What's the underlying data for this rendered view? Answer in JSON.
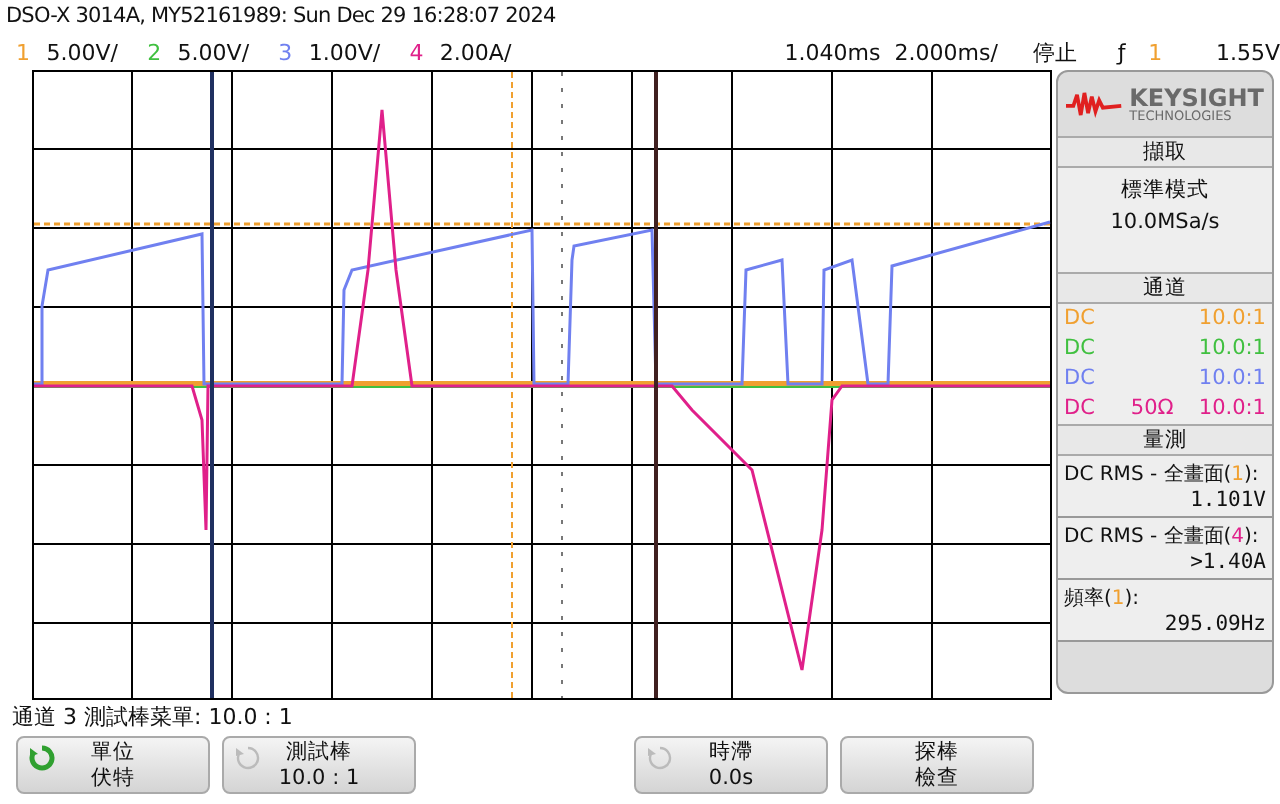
{
  "title": "DSO-X 3014A, MY52161989: Sun Dec 29 16:28:07 2024",
  "channels": [
    {
      "number": "1",
      "scale": "5.00V/",
      "color": "#f0a030"
    },
    {
      "number": "2",
      "scale": "5.00V/",
      "color": "#40c040"
    },
    {
      "number": "3",
      "scale": "1.00V/",
      "color": "#7080f0"
    },
    {
      "number": "4",
      "scale": "2.00A/",
      "color": "#e0208a"
    }
  ],
  "delay": "1.040ms",
  "timebase": "2.000ms/",
  "run_state": "停止",
  "trigger": {
    "slope": "ƒ",
    "channel": "1",
    "level": "1.55V",
    "color": "#f0a030"
  },
  "logo": {
    "brand": "KEYSIGHT",
    "sub": "TECHNOLOGIES"
  },
  "acquisition": {
    "header": "擷取",
    "mode": "標準模式",
    "rate": "10.0MSa/s"
  },
  "channel_panel": {
    "header": "通道",
    "rows": [
      {
        "coupling": "DC",
        "ratio": "10.0:1",
        "color": "#f0a030"
      },
      {
        "coupling": "DC",
        "ratio": "10.0:1",
        "color": "#40c040"
      },
      {
        "coupling": "DC",
        "ratio": "10.0:1",
        "color": "#7080f0"
      },
      {
        "coupling": "DC",
        "impedance": "50Ω",
        "ratio": "10.0:1",
        "color": "#e0208a"
      }
    ]
  },
  "measurements": {
    "header": "量測",
    "items": [
      {
        "label": "DC RMS - 全畫面(",
        "source": "1",
        "suffix": "):",
        "value": "1.101V",
        "color": "#f0a030"
      },
      {
        "label": "DC RMS - 全畫面(",
        "source": "4",
        "suffix": "):",
        "value": ">1.40A",
        "color": "#e0208a"
      },
      {
        "label": "頻率(",
        "source": "1",
        "suffix": "):",
        "value": "295.09Hz",
        "color": "#f0a030"
      }
    ]
  },
  "status_line": "通道 3 測試棒菜單: 10.0 : 1",
  "softkeys": [
    {
      "label": "單位",
      "value": "伏特",
      "kind": "active"
    },
    {
      "label": "測試棒",
      "value": "10.0 : 1",
      "kind": "inactive"
    },
    {
      "kind": "blank"
    },
    {
      "label": "時滯",
      "value": "0.0s",
      "kind": "inactive"
    },
    {
      "label": "探棒",
      "value": "檢查",
      "kind": "plain"
    }
  ]
}
